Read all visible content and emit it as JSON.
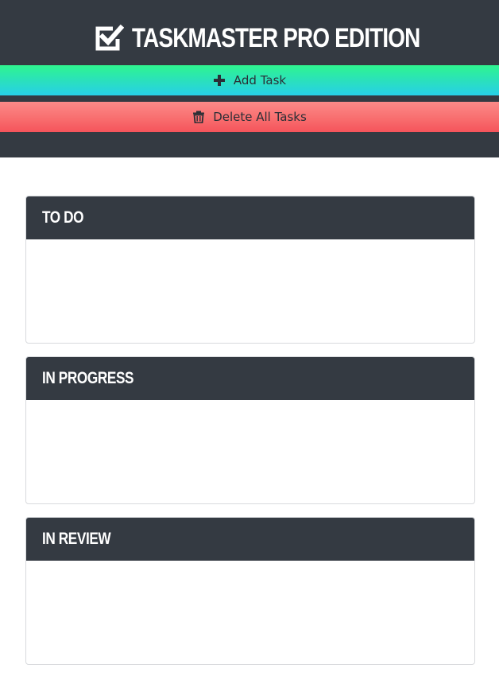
{
  "app": {
    "title": "TASKMASTER PRO EDITION",
    "title_icon": "checkbox-checked-icon"
  },
  "toolbar": {
    "add_label": "Add Task",
    "add_icon": "plus-icon",
    "delete_label": "Delete All Tasks",
    "delete_icon": "trash-icon"
  },
  "lanes": [
    {
      "title": "TO DO",
      "tasks": []
    },
    {
      "title": "IN PROGRESS",
      "tasks": []
    },
    {
      "title": "IN REVIEW",
      "tasks": []
    }
  ],
  "colors": {
    "header_bg": "#343a42",
    "add_gradient_top": "#2ff58f",
    "add_gradient_bottom": "#27d0e8",
    "delete_gradient_top": "#fb8a88",
    "delete_gradient_bottom": "#f5545b"
  }
}
